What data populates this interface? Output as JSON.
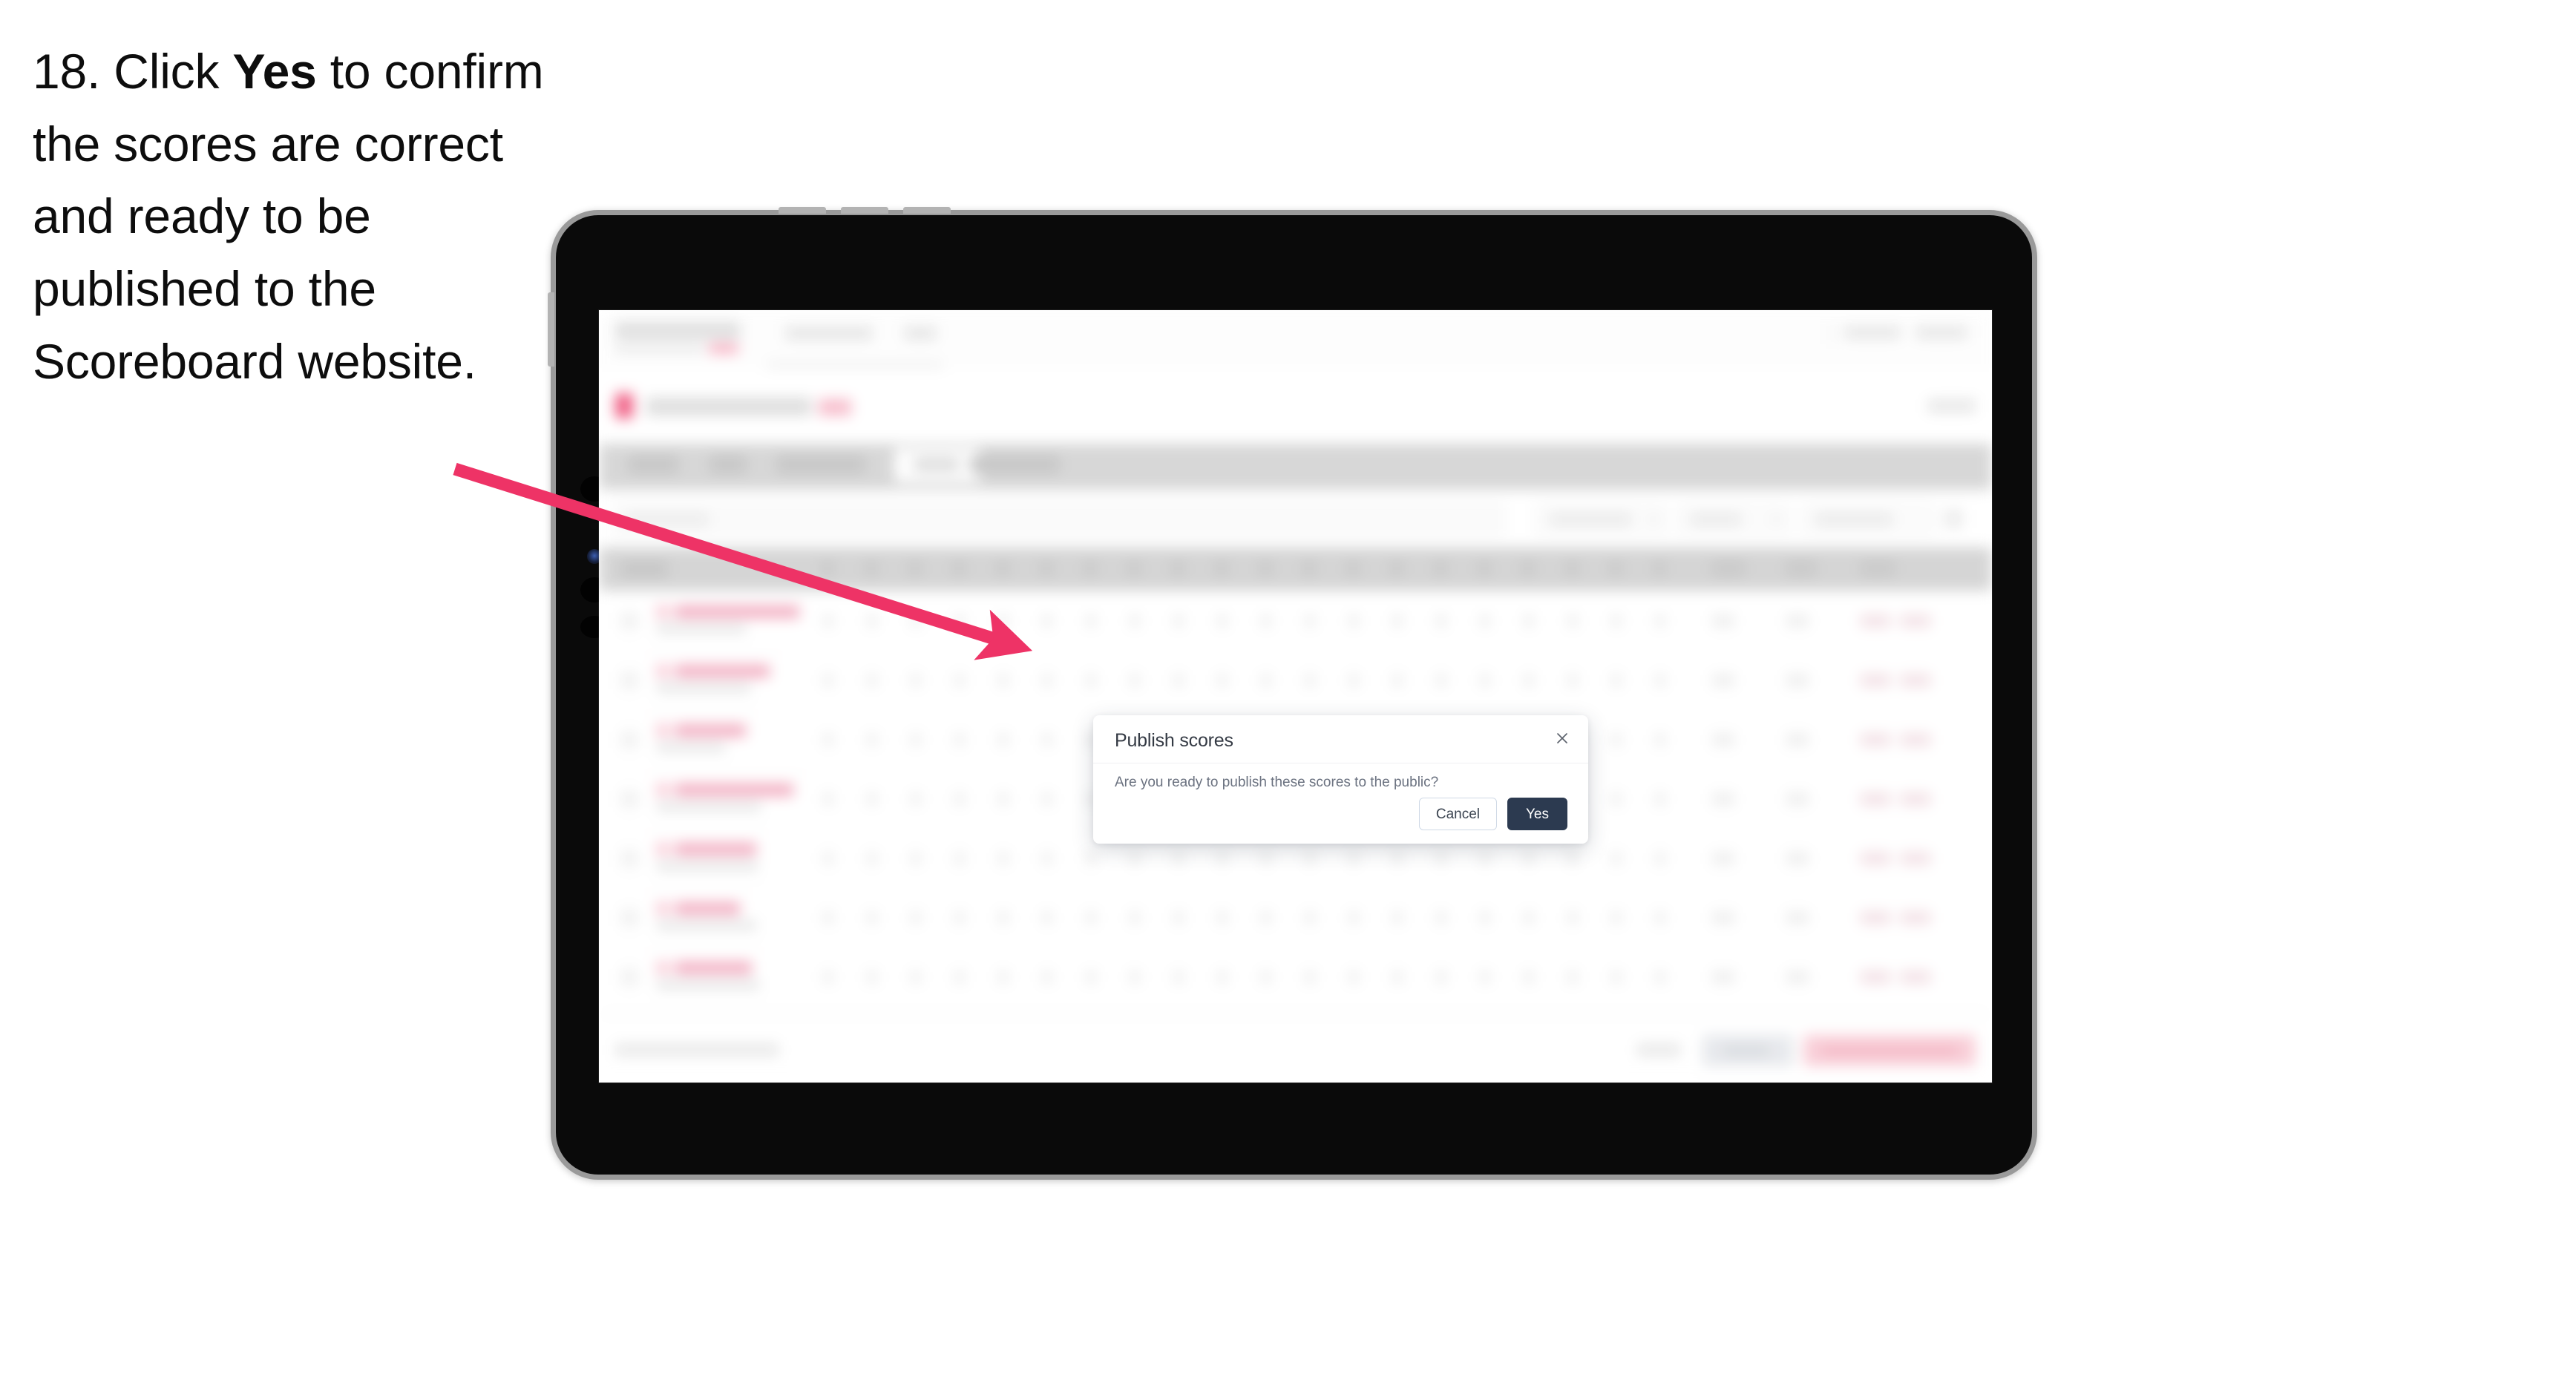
{
  "instruction": {
    "step_number": "18.",
    "text_before": "Click ",
    "emphasis": "Yes",
    "text_after": " to confirm the scores are correct and ready to be published to the Scoreboard website."
  },
  "annotation": {
    "arrow_color": "#ee3366",
    "arrow_name": "pointer-arrow",
    "points_to": "publish-scores-dialog"
  },
  "device": {
    "type": "tablet",
    "frame_color": "#9a9a9a",
    "bezel_color": "#0a0a0a"
  },
  "app": {
    "blurred": true,
    "note": "Background scoreboard application is out of focus; text is not legible.",
    "tab_bar": {
      "active_tab_index": 3,
      "tab_count": 5
    },
    "table": {
      "visible_rows": 7,
      "score_columns": 20
    }
  },
  "dialog": {
    "title": "Publish scores",
    "body": "Are you ready to publish these scores to the public?",
    "close_icon": "close-icon",
    "cancel_label": "Cancel",
    "confirm_label": "Yes",
    "confirm_color": "#2c3a50",
    "cancel_border_color": "#cfd9e6"
  }
}
